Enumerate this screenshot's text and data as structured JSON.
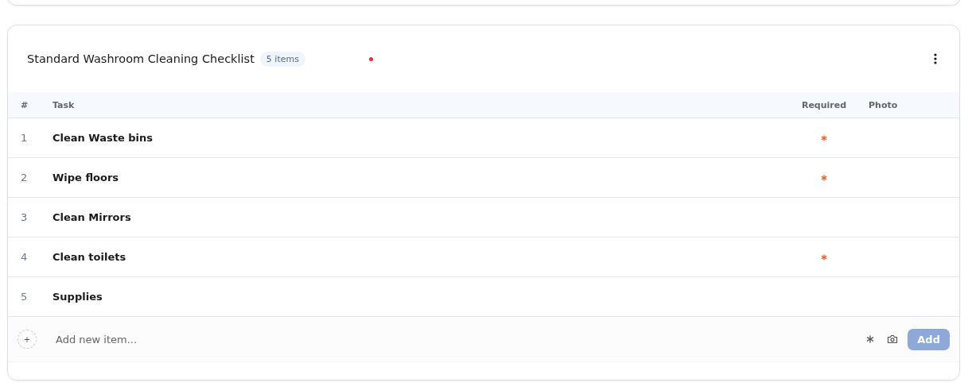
{
  "checklist": {
    "title": "Standard Washroom Cleaning Checklist",
    "count_badge": "5 items",
    "columns": [
      "#",
      "Task",
      "Required",
      "Photo"
    ],
    "rows": [
      {
        "number": "1",
        "task": "Clean Waste bins",
        "required": true
      },
      {
        "number": "2",
        "task": "Wipe floors",
        "required": true
      },
      {
        "number": "3",
        "task": "Clean Mirrors",
        "required": false
      },
      {
        "number": "4",
        "task": "Clean toilets",
        "required": true
      },
      {
        "number": "5",
        "task": "Supplies",
        "required": false
      }
    ],
    "add_row": {
      "plus": "+",
      "placeholder": "Add new item...",
      "button": "Add"
    }
  }
}
